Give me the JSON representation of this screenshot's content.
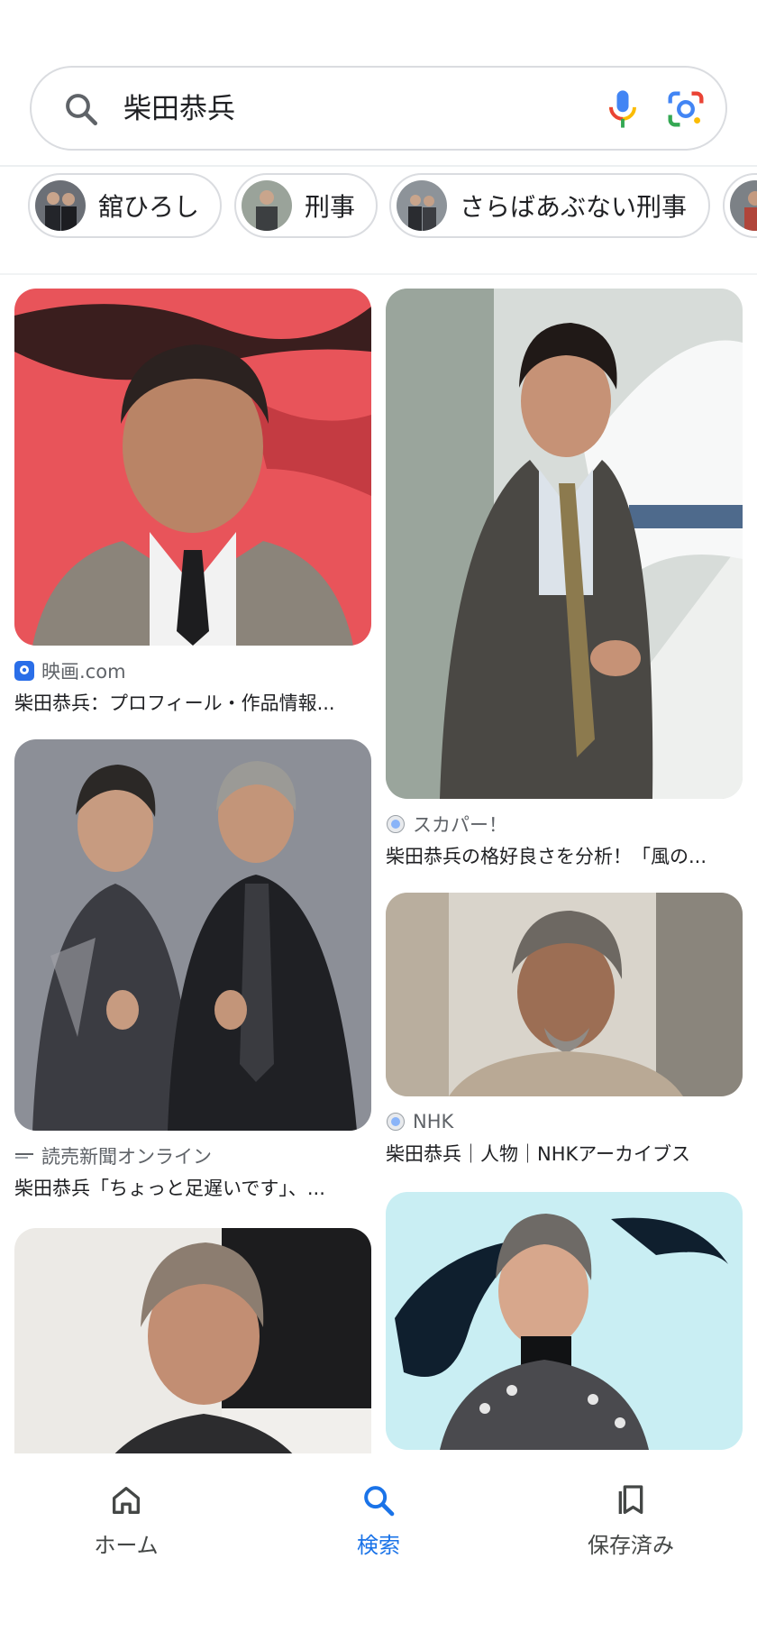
{
  "search": {
    "query": "柴田恭兵",
    "icons": [
      "search-icon",
      "mic-icon",
      "lens-icon"
    ]
  },
  "chips": [
    {
      "label": "舘ひろし"
    },
    {
      "label": "刑事"
    },
    {
      "label": "さらばあぶない刑事"
    }
  ],
  "results": [
    {
      "source": "映画.com",
      "title": "柴田恭兵：プロフィール・作品情報..."
    },
    {
      "source": "スカパー！",
      "title": "柴田恭兵の格好良さを分析！「風の..."
    },
    {
      "source": "読売新聞オンライン",
      "title": "柴田恭兵「ちょっと足遅いです」、..."
    },
    {
      "source": "NHK",
      "title": "柴田恭兵｜人物｜NHKアーカイブス"
    }
  ],
  "nav": {
    "home": "ホーム",
    "search": "検索",
    "saved": "保存済み",
    "active": "search"
  },
  "colors": {
    "accent": "#1a73e8",
    "text": "#202124",
    "muted": "#5f6368"
  }
}
